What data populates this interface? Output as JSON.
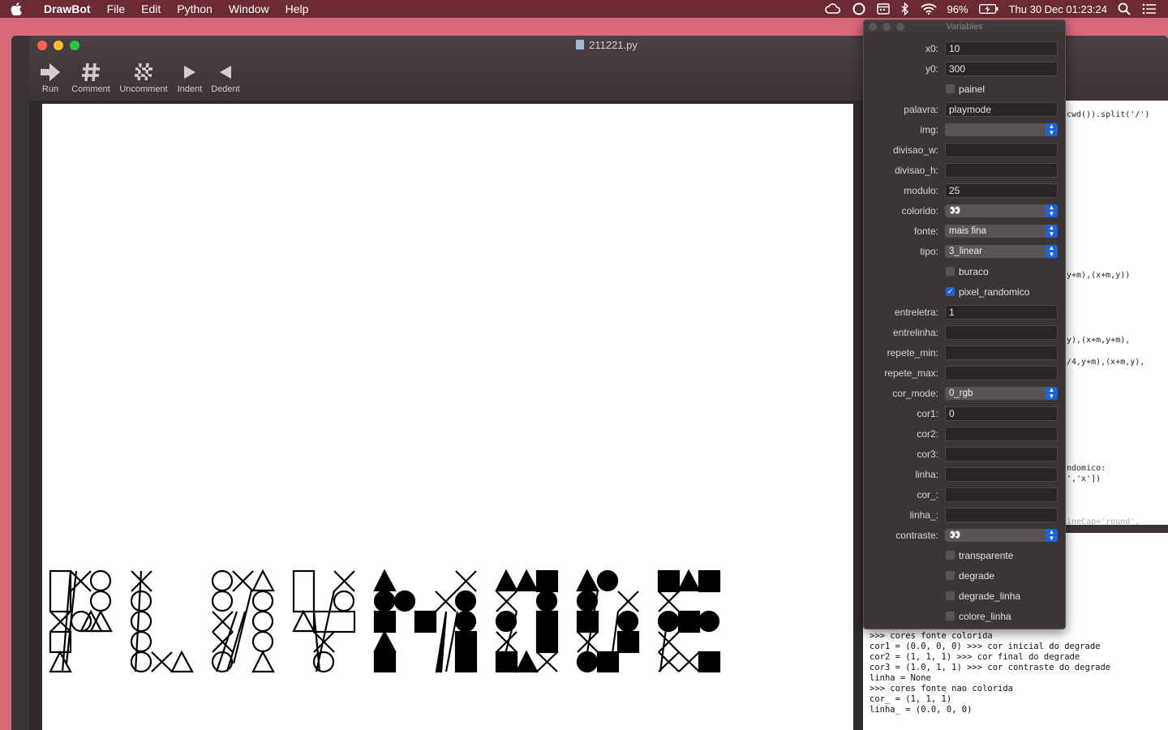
{
  "menubar": {
    "app_name": "DrawBot",
    "menus": [
      "File",
      "Edit",
      "Python",
      "Window",
      "Help"
    ],
    "battery": "96%",
    "datetime": "Thu 30 Dec  01:23:24"
  },
  "window": {
    "title": "211221.py",
    "toolbar": [
      {
        "label": "Run",
        "icon": "run-arrow-icon"
      },
      {
        "label": "Comment",
        "icon": "hash-icon"
      },
      {
        "label": "Uncomment",
        "icon": "hash-crossed-icon"
      },
      {
        "label": "Indent",
        "icon": "triangle-right-icon"
      },
      {
        "label": "Dedent",
        "icon": "triangle-left-icon"
      }
    ]
  },
  "code_fragments": [
    "cwd()).split('/')",
    "y+m),(x+m,y))",
    "y),(x+m,y+m),",
    "/4,y+m),(x+m,y),",
    "ndomico:",
    "','x'])",
    "ineCap='round',"
  ],
  "output_lines": [
    ">>> cores fonte colorida",
    "cor1 = (0.0, 0, 0) >>> cor inicial do degrade",
    "cor2 = (1, 1, 1) >>> cor final do degrade",
    "cor3 = (1.0, 1, 1) >>> cor contraste do degrade",
    "linha = None",
    ">>> cores fonte nao colorida",
    "cor_ = (1, 1, 1)",
    "linha_ = (0.0, 0, 0)"
  ],
  "variables_panel": {
    "title": "Variables",
    "rows": [
      {
        "type": "text",
        "label": "x0:",
        "value": "10"
      },
      {
        "type": "text",
        "label": "y0:",
        "value": "300"
      },
      {
        "type": "check",
        "label": "painel",
        "checked": false
      },
      {
        "type": "text",
        "label": "palavra:",
        "value": "playmode"
      },
      {
        "type": "popup",
        "label": "img:",
        "value": ""
      },
      {
        "type": "text",
        "label": "divisao_w:",
        "value": ""
      },
      {
        "type": "text",
        "label": "divisao_h:",
        "value": ""
      },
      {
        "type": "text",
        "label": "modulo:",
        "value": "25"
      },
      {
        "type": "popup",
        "label": "colorido:",
        "value": "👀"
      },
      {
        "type": "popup",
        "label": "fonte:",
        "value": "mais fina"
      },
      {
        "type": "popup",
        "label": "tipo:",
        "value": "3_linear"
      },
      {
        "type": "check",
        "label": "buraco",
        "checked": false
      },
      {
        "type": "check",
        "label": "pixel_randomico",
        "checked": true
      },
      {
        "type": "text",
        "label": "entreletra:",
        "value": "1"
      },
      {
        "type": "text",
        "label": "entrelinha:",
        "value": ""
      },
      {
        "type": "text",
        "label": "repete_min:",
        "value": ""
      },
      {
        "type": "text",
        "label": "repete_max:",
        "value": ""
      },
      {
        "type": "popup",
        "label": "cor_mode:",
        "value": "0_rgb"
      },
      {
        "type": "text",
        "label": "cor1:",
        "value": "0"
      },
      {
        "type": "text",
        "label": "cor2:",
        "value": ""
      },
      {
        "type": "text",
        "label": "cor3:",
        "value": ""
      },
      {
        "type": "text",
        "label": "linha:",
        "value": ""
      },
      {
        "type": "text",
        "label": "cor_:",
        "value": ""
      },
      {
        "type": "text",
        "label": "linha_:",
        "value": ""
      },
      {
        "type": "popup",
        "label": "contraste:",
        "value": "👀"
      },
      {
        "type": "check",
        "label": "transparente",
        "checked": false
      },
      {
        "type": "check",
        "label": "degrade",
        "checked": false
      },
      {
        "type": "check",
        "label": "degrade_linha",
        "checked": false
      },
      {
        "type": "check",
        "label": "colore_linha",
        "checked": false
      }
    ]
  },
  "canvas": {
    "word": "playmode"
  }
}
